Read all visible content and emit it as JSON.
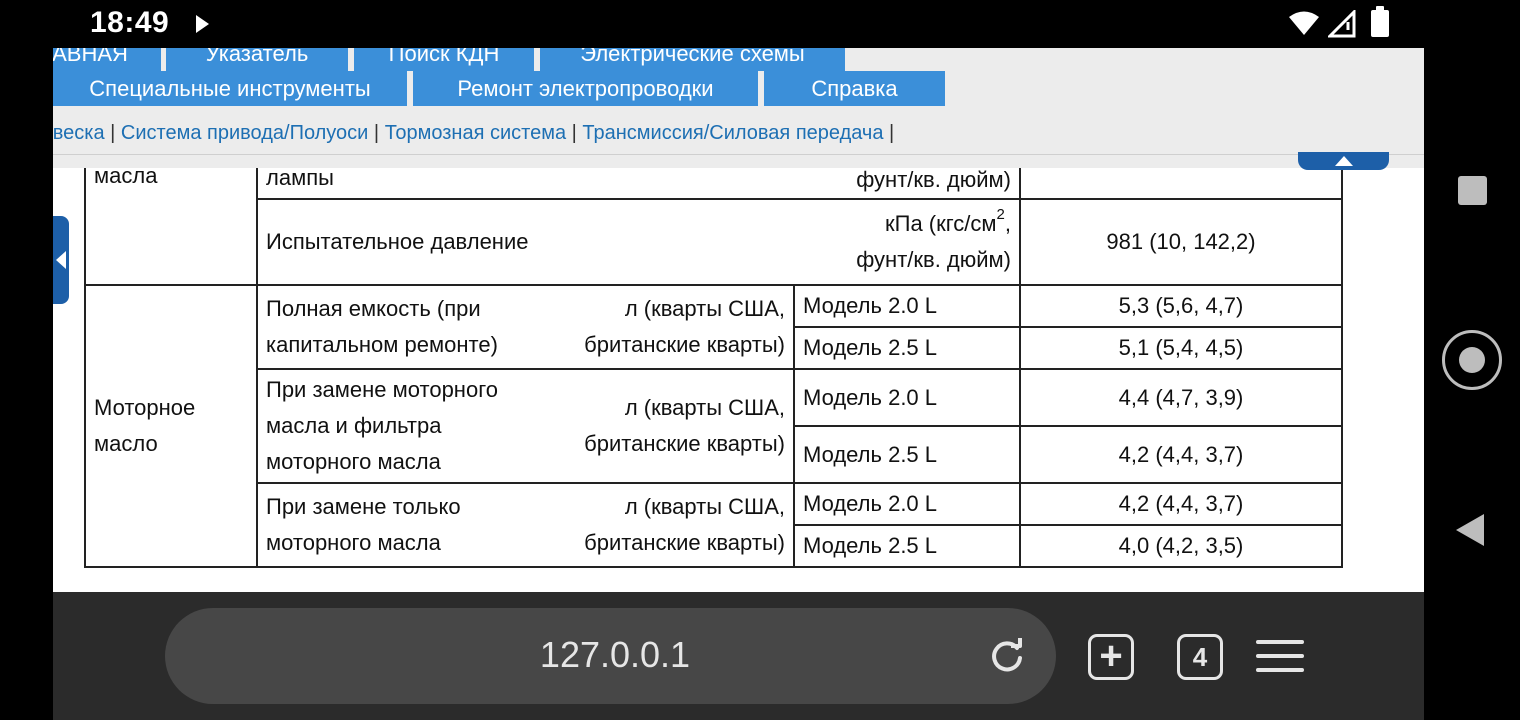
{
  "status_bar": {
    "time": "18:49",
    "icons": [
      "play-icon",
      "wifi-icon",
      "signal-icon",
      "battery-icon"
    ]
  },
  "header": {
    "nav_row1": [
      "ГЛАВНАЯ",
      "Указатель",
      "Поиск КДН",
      "Электрические схемы"
    ],
    "nav_row2": [
      "Специальные инструменты",
      "Ремонт электропроводки",
      "Справка"
    ],
    "nav_color": "#3b8fd9",
    "breadcrumbs": [
      "Подвеска",
      "Система привода/Полуоси",
      "Тормозная система",
      "Трансмиссия/Силовая передача"
    ]
  },
  "table": {
    "row_top": {
      "category": "масла",
      "item": "лампы",
      "unit": "фунт/кв. дюйм)"
    },
    "row_test": {
      "item": "Испытательное давление",
      "unit_line1": "кПа (кгс/см",
      "unit_sup": "2",
      "unit_line1_end": ",",
      "unit_line2": "фунт/кв. дюйм)",
      "value": "981 (10, 142,2)"
    },
    "engine_oil": {
      "category_line1": "Моторное",
      "category_line2": "масло",
      "groups": [
        {
          "item_line1": "Полная емкость (при",
          "item_line2": "капитальном ремонте)",
          "item_line3": "",
          "unit_line1": "л (кварты США,",
          "unit_line2": "британские кварты)",
          "rows": [
            {
              "model": "Модель 2.0 L",
              "value": "5,3 (5,6, 4,7)"
            },
            {
              "model": "Модель 2.5 L",
              "value": "5,1 (5,4, 4,5)"
            }
          ]
        },
        {
          "item_line1": "При замене моторного",
          "item_line2": "масла и фильтра",
          "item_line3": "моторного масла",
          "unit_line1": "л (кварты США,",
          "unit_line2": "британские кварты)",
          "rows": [
            {
              "model": "Модель 2.0 L",
              "value": "4,4 (4,7, 3,9)"
            },
            {
              "model": "Модель 2.5 L",
              "value": "4,2 (4,4, 3,7)"
            }
          ]
        },
        {
          "item_line1": "При замене только",
          "item_line2": "моторного масла",
          "item_line3": "",
          "unit_line1": "л (кварты США,",
          "unit_line2": "британские кварты)",
          "rows": [
            {
              "model": "Модель 2.0 L",
              "value": "4,2 (4,4, 3,7)"
            },
            {
              "model": "Модель 2.5 L",
              "value": "4,0 (4,2, 3,5)"
            }
          ]
        }
      ]
    }
  },
  "browser": {
    "url": "127.0.0.1",
    "tab_count": "4",
    "new_tab_glyph": "+"
  }
}
